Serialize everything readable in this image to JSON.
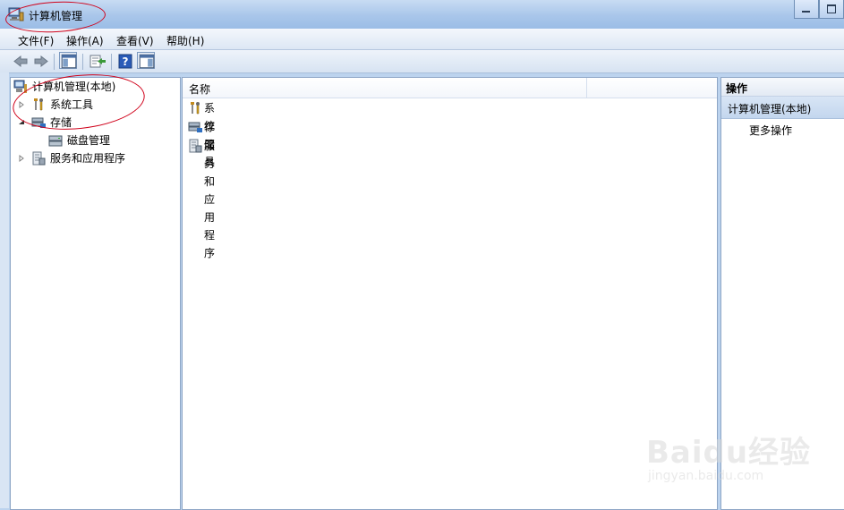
{
  "window": {
    "title": "计算机管理"
  },
  "menubar": {
    "items": [
      "文件(F)",
      "操作(A)",
      "查看(V)",
      "帮助(H)"
    ]
  },
  "toolbar": {
    "icons": [
      "back-arrow-icon",
      "forward-arrow-icon",
      "show-hide-console-tree-icon",
      "export-list-icon",
      "help-icon",
      "show-hide-action-pane-icon"
    ]
  },
  "tree": {
    "root": "计算机管理(本地)",
    "items": [
      {
        "label": "系统工具",
        "expanded": false
      },
      {
        "label": "存储",
        "expanded": true,
        "children": [
          "磁盘管理"
        ]
      },
      {
        "label": "服务和应用程序",
        "expanded": false
      }
    ]
  },
  "list": {
    "column_header": "名称",
    "rows": [
      "系统工具",
      "存储",
      "服务和应用程序"
    ]
  },
  "actions": {
    "header": "操作",
    "section": "计算机管理(本地)",
    "more": "更多操作"
  },
  "watermark": {
    "main": "Baidu经验",
    "sub": "jingyan.baidu.com"
  },
  "colors": {
    "annotation": "#d0021b",
    "selection": "#c3d6ee"
  }
}
